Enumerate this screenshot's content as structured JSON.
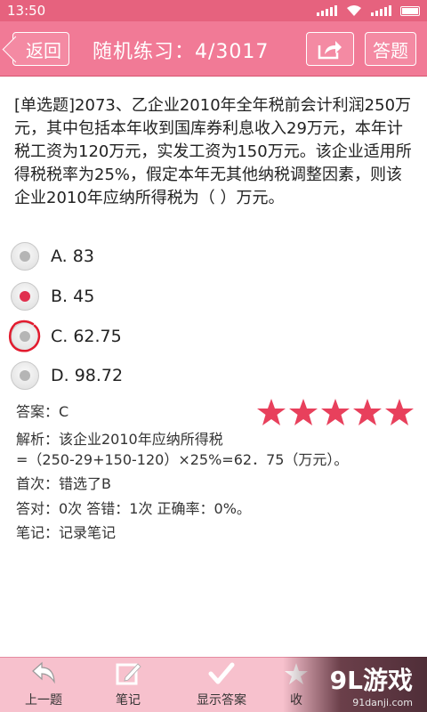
{
  "status_bar": {
    "time": "13:50"
  },
  "header": {
    "back_label": "返回",
    "title": "随机练习：4/3017",
    "share_icon": "share-icon",
    "answer_label": "答题"
  },
  "question": {
    "text": "[单选题]2073、乙企业2010年全年税前会计利润250万元，其中包括本年收到国库券利息收入29万元，本年计税工资为120万元，实发工资为150万元。该企业适用所得税税率为25%，假定本年无其他纳税调整因素，则该企业2010年应纳所得税为（ ）万元。"
  },
  "options": [
    {
      "label": "A. 83",
      "selected": false
    },
    {
      "label": "B. 45",
      "selected": true
    },
    {
      "label": "C. 62.75",
      "selected": false,
      "annotated": true
    },
    {
      "label": "D. 98.72",
      "selected": false
    }
  ],
  "result": {
    "answer": "答案：C",
    "rating": 5,
    "analysis_line1": "解析：该企业2010年应纳所得税",
    "analysis_line2": "=（250-29+150-120）×25%=62．75（万元）。",
    "first_attempt": "首次：错选了B",
    "stats": "答对：0次  答错：1次 正确率：0%。",
    "note": "笔记：记录笔记"
  },
  "bottom_tabs": [
    {
      "label": "上一题",
      "icon": "undo-arrow-icon"
    },
    {
      "label": "笔记",
      "icon": "edit-note-icon"
    },
    {
      "label": "显示答案",
      "icon": "checkmark-icon"
    },
    {
      "label": "收",
      "icon": "favorite-icon"
    }
  ],
  "watermark": {
    "main": "9L游戏",
    "sub": "91danji.com"
  },
  "colors": {
    "accent": "#f17a96",
    "selected_dot": "#e0304e",
    "star": "#e8405c",
    "bottom_bar": "#f7c1cd"
  }
}
